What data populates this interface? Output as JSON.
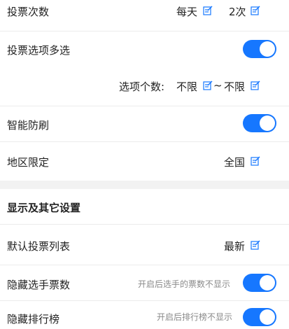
{
  "accent_color": "#1677ff",
  "vote_times": {
    "label": "投票次数",
    "period": "每天",
    "count": "2次"
  },
  "multi_choice": {
    "label": "投票选项多选",
    "enabled": true,
    "range_label": "选项个数:",
    "min": "不限",
    "separator": "~",
    "max": "不限"
  },
  "anti_brush": {
    "label": "智能防刷",
    "enabled": true
  },
  "region_limit": {
    "label": "地区限定",
    "value": "全国"
  },
  "display_section": {
    "title": "显示及其它设置"
  },
  "default_list": {
    "label": "默认投票列表",
    "value": "最新"
  },
  "hide_votes": {
    "label": "隐藏选手票数",
    "hint": "开启后选手的票数不显示",
    "enabled": true
  },
  "hide_ranking": {
    "label": "隐藏排行榜",
    "hint": "开启后排行榜不显示",
    "enabled": true
  }
}
